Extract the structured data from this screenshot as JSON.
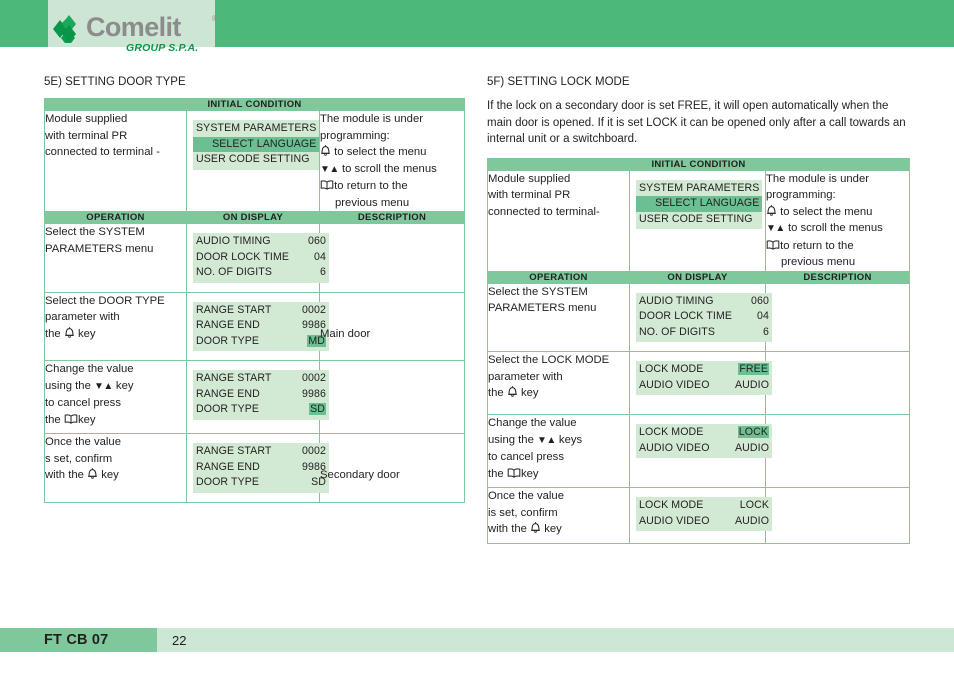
{
  "header": {
    "logo_word": "Comelit",
    "logo_reg": "®",
    "logo_sub": "GROUP S.P.A.",
    "logo_mark_icon": "comelit-diamond-icon",
    "band_color": "#4cb87a",
    "logo_box_color": "#cde5d3"
  },
  "colors": {
    "table_header_green": "#7fc89c",
    "lcd_bg": "#d2e9d4",
    "lcd_highlight": "#6cbf92",
    "border": "#7fc89c",
    "brand_green": "#0a9648"
  },
  "left_section": {
    "title": "5E) SETTING DOOR TYPE",
    "initial_condition_label": "INITIAL CONDITION",
    "columns": [
      "OPERATION",
      "ON DISPLAY",
      "DESCRIPTION"
    ],
    "initial": {
      "operation_lines": [
        "Module supplied",
        "with terminal PR",
        "connected to terminal -"
      ],
      "display": {
        "lines": [
          {
            "text": "SYSTEM PARAMETERS",
            "highlight": false,
            "align": "left"
          },
          {
            "text": "SELECT LANGUAGE",
            "highlight": true,
            "align": "right"
          },
          {
            "text": "USER CODE SETTING",
            "highlight": false,
            "align": "left"
          }
        ]
      },
      "description": {
        "intro": "The module is under",
        "intro2": "programming:",
        "items": [
          {
            "icon": "bell-icon",
            "text": "to select the menu"
          },
          {
            "icon": "updown-arrows-icon",
            "text": "to scroll the menus"
          },
          {
            "icon": "book-icon",
            "text": "to return to the"
          }
        ],
        "continuation": "previous menu"
      }
    },
    "rows": [
      {
        "operation_lines": [
          "Select the SYSTEM",
          "PARAMETERS menu"
        ],
        "display": [
          {
            "label": "AUDIO TIMING",
            "value": "060",
            "value_hl": false
          },
          {
            "label": "DOOR LOCK TIME",
            "value": "04",
            "value_hl": false
          },
          {
            "label": "NO. OF DIGITS",
            "value": "6",
            "value_hl": false
          }
        ],
        "description": ""
      },
      {
        "operation_lines": [
          "Select the DOOR TYPE",
          "parameter with",
          "the {bell} key"
        ],
        "display": [
          {
            "label": "RANGE START",
            "value": "0002",
            "value_hl": false
          },
          {
            "label": "RANGE END",
            "value": "9986",
            "value_hl": false
          },
          {
            "label": "DOOR TYPE",
            "value": "MD",
            "value_hl": true
          }
        ],
        "description": "Main door"
      },
      {
        "operation_lines": [
          "Change the value",
          "using the {arrows} key",
          "to cancel press",
          "the {book} key"
        ],
        "display": [
          {
            "label": "RANGE START",
            "value": "0002",
            "value_hl": false
          },
          {
            "label": "RANGE END",
            "value": "9986",
            "value_hl": false
          },
          {
            "label": "DOOR TYPE",
            "value": "SD",
            "value_hl": true
          }
        ],
        "description": ""
      },
      {
        "operation_lines": [
          "Once the  value",
          "s set, confirm",
          "with the {bell} key"
        ],
        "display": [
          {
            "label": "RANGE START",
            "value": "0002",
            "value_hl": false
          },
          {
            "label": "RANGE END",
            "value": "9986",
            "value_hl": false
          },
          {
            "label": "DOOR TYPE",
            "value": "SD",
            "value_hl": false
          }
        ],
        "description": "Secondary door"
      }
    ]
  },
  "right_section": {
    "title": "5F) SETTING LOCK MODE",
    "intro": "If the lock on a secondary door is set FREE, it will open automatically when the main door is opened. If it is set LOCK it can be opened only after a call towards an internal unit or a switchboard.",
    "initial_condition_label": "INITIAL CONDITION",
    "columns": [
      "OPERATION",
      "ON DISPLAY",
      "DESCRIPTION"
    ],
    "initial": {
      "operation_lines": [
        "Module supplied",
        "with terminal PR",
        "connected to terminal-"
      ],
      "display": {
        "lines": [
          {
            "text": "SYSTEM PARAMETERS",
            "highlight": false,
            "align": "left"
          },
          {
            "text": "SELECT LANGUAGE",
            "highlight": true,
            "align": "right"
          },
          {
            "text": "USER CODE SETTING",
            "highlight": false,
            "align": "left"
          }
        ]
      },
      "description": {
        "intro": "The module is under",
        "intro2": "programming:",
        "items": [
          {
            "icon": "bell-icon",
            "text": "to select the menu"
          },
          {
            "icon": "updown-arrows-icon",
            "text": "to scroll the menus"
          },
          {
            "icon": "book-icon",
            "text": "to return to the"
          }
        ],
        "continuation": "previous menu"
      }
    },
    "rows": [
      {
        "operation_lines": [
          "Select the SYSTEM",
          "PARAMETERS menu"
        ],
        "display": [
          {
            "label": "AUDIO TIMING",
            "value": "060",
            "value_hl": false
          },
          {
            "label": "DOOR LOCK TIME",
            "value": "04",
            "value_hl": false
          },
          {
            "label": "NO. OF DIGITS",
            "value": "6",
            "value_hl": false
          }
        ],
        "description": ""
      },
      {
        "operation_lines": [
          "Select the LOCK MODE",
          "parameter with",
          "the {bell} key"
        ],
        "display": [
          {
            "label": "LOCK MODE",
            "value": "FREE",
            "value_hl": true
          },
          {
            "label": "AUDIO VIDEO",
            "value": "AUDIO",
            "value_hl": false
          }
        ],
        "description": ""
      },
      {
        "operation_lines": [
          "Change the value",
          "using  the {arrows} keys",
          "to cancel press",
          "the {book} key"
        ],
        "display": [
          {
            "label": "LOCK MODE",
            "value": "LOCK",
            "value_hl": true
          },
          {
            "label": "AUDIO VIDEO",
            "value": "AUDIO",
            "value_hl": false
          }
        ],
        "description": ""
      },
      {
        "operation_lines": [
          "Once the  value",
          "is set, confirm",
          "with the {bell} key"
        ],
        "display": [
          {
            "label": "LOCK MODE",
            "value": "LOCK",
            "value_hl": false
          },
          {
            "label": "AUDIO VIDEO",
            "value": "AUDIO",
            "value_hl": false
          }
        ],
        "description": ""
      }
    ]
  },
  "footer": {
    "code": "FT CB 07",
    "page": "22"
  }
}
